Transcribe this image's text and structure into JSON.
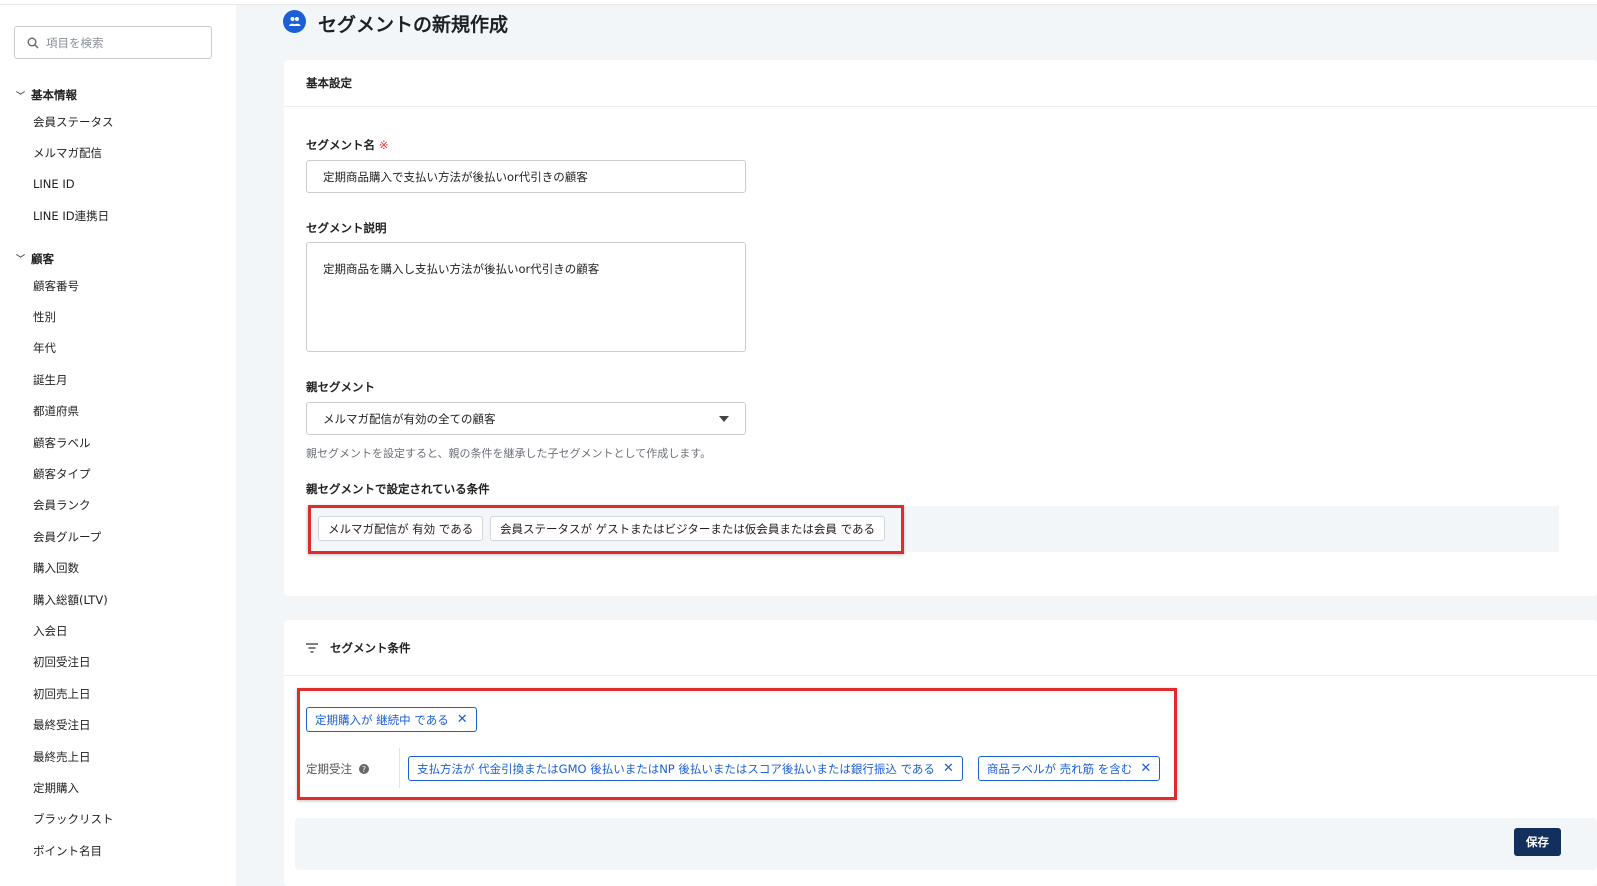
{
  "sidebar": {
    "search_placeholder": "項目を検索",
    "groups": [
      {
        "label": "基本情報",
        "items": [
          "会員ステータス",
          "メルマガ配信",
          "LINE ID",
          "LINE ID連携日"
        ]
      },
      {
        "label": "顧客",
        "items": [
          "顧客番号",
          "性別",
          "年代",
          "誕生月",
          "都道府県",
          "顧客ラベル",
          "顧客タイプ",
          "会員ランク",
          "会員グループ",
          "購入回数",
          "購入総額(LTV)",
          "入会日",
          "初回受注日",
          "初回売上日",
          "最終受注日",
          "最終売上日",
          "定期購入",
          "ブラックリスト",
          "ポイント名目"
        ]
      }
    ]
  },
  "page": {
    "title": "セグメントの新規作成"
  },
  "basic": {
    "heading": "基本設定",
    "name_label": "セグメント名",
    "required_mark": "※",
    "name_value": "定期商品購入で支払い方法が後払いor代引きの顧客",
    "desc_label": "セグメント説明",
    "desc_value": "定期商品を購入し支払い方法が後払いor代引きの顧客",
    "parent_label": "親セグメント",
    "parent_value": "メルマガ配信が有効の全ての顧客",
    "parent_help": "親セグメントを設定すると、親の条件を継承した子セグメントとして作成します。",
    "parent_cond_label": "親セグメントで設定されている条件",
    "parent_conditions": [
      "メルマガ配信が 有効 である",
      "会員ステータスが ゲストまたはビジターまたは仮会員または会員 である"
    ]
  },
  "conditions": {
    "heading": "セグメント条件",
    "top_tag": "定期購入が 継続中 である",
    "group_label": "定期受注",
    "group_tags": [
      "支払方法が 代金引換またはGMO 後払いまたはNP 後払いまたはスコア後払いまたは銀行振込 である",
      "商品ラベルが 売れ筋 を含む"
    ],
    "remove_glyph": "✕"
  },
  "footer": {
    "save_label": "保存"
  },
  "colors": {
    "accent": "#1a5fd6",
    "save": "#12305e",
    "annotation": "#e02b2b"
  }
}
